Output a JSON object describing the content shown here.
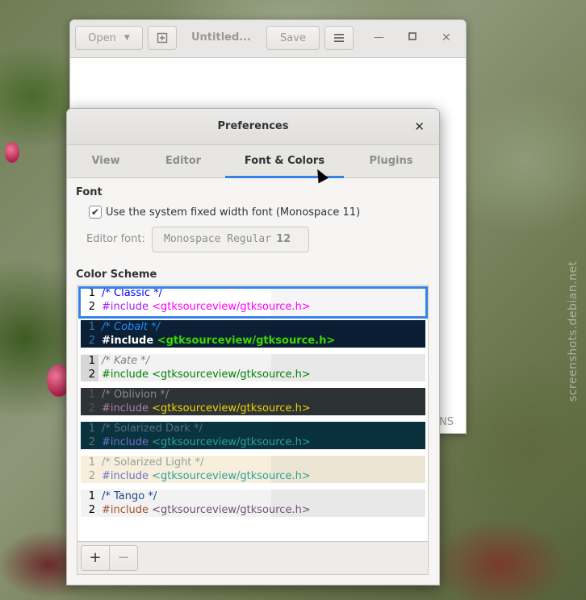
{
  "watermark": "screenshots.debian.net",
  "editor": {
    "open_label": "Open",
    "title": "Untitled...",
    "save_label": "Save",
    "footer_text": "NS"
  },
  "prefs": {
    "title": "Preferences",
    "tabs": [
      {
        "label": "View"
      },
      {
        "label": "Editor"
      },
      {
        "label": "Font & Colors"
      },
      {
        "label": "Plugins"
      }
    ],
    "active_tab": "Font & Colors",
    "font_section": "Font",
    "use_system_font_label": "Use the system fixed width font (Monospace 11)",
    "use_system_font_checked": true,
    "editor_font_label": "Editor font:",
    "editor_font_name": "Monospace Regular",
    "editor_font_size": "12",
    "color_scheme_section": "Color Scheme",
    "schemes": [
      {
        "name": "Classic",
        "line1": "/* Classic */",
        "line2_kw": "#include",
        "line2_rest": " <gtksourceview/gtksource.h>",
        "bg": "#ffffff",
        "ln_color": "#000000",
        "ln_bg": "#ffffff",
        "comment": "#0000ff",
        "kw": "#a020f0",
        "str": "#ff00ff",
        "selected": true
      },
      {
        "name": "Cobalt",
        "line1": "/* Cobalt */",
        "line2_kw": "#include",
        "line2_rest": " <gtksourceview/gtksource.h>",
        "bg": "#0b1f35",
        "ln_color": "#3d73a8",
        "ln_bg": "#0b1f35",
        "comment": "#1e90ff",
        "kw": "#ffffff",
        "str": "#3ad900",
        "selected": false
      },
      {
        "name": "Kate",
        "line1": "/* Kate */",
        "line2_kw": "#include",
        "line2_rest": " <gtksourceview/gtksource.h>",
        "bg": "#f2f2f2",
        "ln_color": "#000000",
        "ln_bg": "#d6d6d6",
        "comment": "#808080",
        "kw": "#008000",
        "str": "#008000",
        "selected": false
      },
      {
        "name": "Oblivion",
        "line1": "/* Oblivion */",
        "line2_kw": "#include",
        "line2_rest": " <gtksourceview/gtksource.h>",
        "bg": "#2e3436",
        "ln_color": "#555753",
        "ln_bg": "#2e3436",
        "comment": "#888a85",
        "kw": "#ad7fa8",
        "str": "#edd400",
        "selected": false
      },
      {
        "name": "Solarized Dark",
        "line1": "/* Solarized Dark */",
        "line2_kw": "#include",
        "line2_rest": " <gtksourceview/gtksource.h>",
        "bg": "#0a3340",
        "ln_color": "#586e75",
        "ln_bg": "#0a3340",
        "comment": "#586e75",
        "kw": "#6c71c4",
        "str": "#2aa198",
        "selected": false
      },
      {
        "name": "Solarized Light",
        "line1": "/* Solarized Light */",
        "line2_kw": "#include",
        "line2_rest": " <gtksourceview/gtksource.h>",
        "bg": "#f7efdc",
        "ln_color": "#93a1a1",
        "ln_bg": "#f7efdc",
        "comment": "#93a1a1",
        "kw": "#6c71c4",
        "str": "#2aa198",
        "selected": false
      },
      {
        "name": "Tango",
        "line1": "/* Tango */",
        "line2_kw": "#include",
        "line2_rest": " <gtksourceview/gtksource.h>",
        "bg": "#f2f2f2",
        "ln_color": "#000000",
        "ln_bg": "#f2f2f2",
        "comment": "#204a87",
        "kw": "#a0522d",
        "str": "#75507b",
        "selected": false
      }
    ],
    "add_label": "+",
    "remove_label": "−"
  }
}
